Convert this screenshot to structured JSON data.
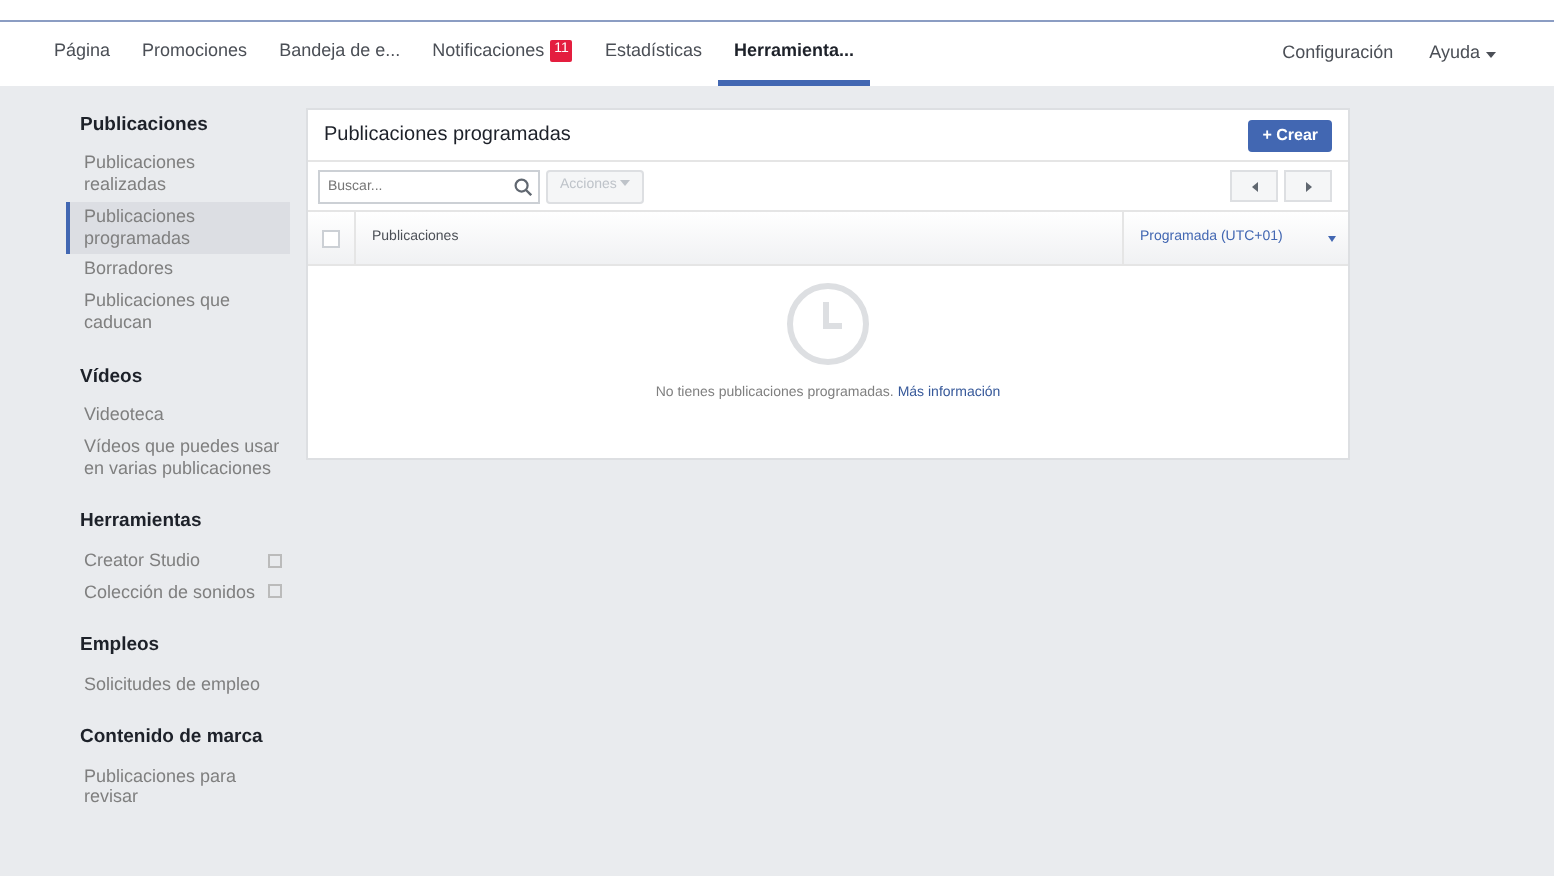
{
  "top_nav": {
    "tabs": [
      {
        "label": "Página",
        "selected": false
      },
      {
        "label": "Promociones",
        "selected": false
      },
      {
        "label": "Bandeja de e...",
        "selected": false
      },
      {
        "label": "Notificaciones",
        "selected": false,
        "badge": "11"
      },
      {
        "label": "Estadísticas",
        "selected": false
      },
      {
        "label": "Herramienta...",
        "selected": true
      }
    ],
    "right_links": [
      {
        "label": "Configuración",
        "kind": "link"
      },
      {
        "label": "Ayuda",
        "kind": "dropdown"
      }
    ]
  },
  "sidebar": {
    "sections": [
      {
        "title": "Publicaciones",
        "items": [
          {
            "label": "Publicaciones realizadas",
            "selected": false
          },
          {
            "label": "Publicaciones programadas",
            "selected": true
          },
          {
            "label": "Borradores",
            "selected": false
          },
          {
            "label": "Publicaciones que caducan",
            "selected": false
          }
        ]
      },
      {
        "title": "Vídeos",
        "items": [
          {
            "label": "Videoteca",
            "selected": false
          },
          {
            "label": "Vídeos que puedes usar en varias publicaciones",
            "selected": false
          }
        ]
      },
      {
        "title": "Herramientas",
        "items": [
          {
            "label": "Creator Studio",
            "selected": false,
            "kind": "external"
          },
          {
            "label": "Colección de sonidos",
            "selected": false,
            "kind": "external"
          }
        ]
      },
      {
        "title": "Empleos",
        "items": [
          {
            "label": "Solicitudes de empleo",
            "selected": false
          }
        ]
      },
      {
        "title": "Contenido de marca",
        "items": [
          {
            "label": "Publicaciones para revisar",
            "selected": false
          }
        ]
      }
    ]
  },
  "panel": {
    "title": "Publicaciones programadas",
    "create_button": "+ Crear",
    "search": {
      "placeholder": "Buscar..."
    },
    "actions_button": "Acciones",
    "table": {
      "select_all_checked": false,
      "columns": [
        "Publicaciones",
        "Programada (UTC+01)"
      ]
    },
    "empty_message": "No tienes publicaciones programadas.",
    "more_link": "Más información"
  }
}
